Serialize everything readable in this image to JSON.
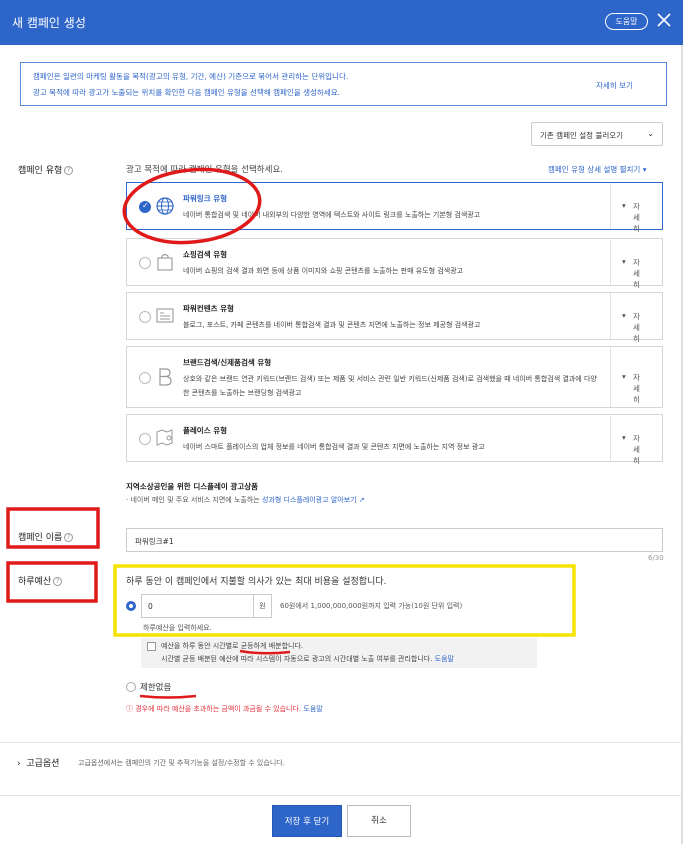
{
  "header": {
    "title": "새 캠페인 생성",
    "help_label": "도움말"
  },
  "info": {
    "line1": "캠페인은 일련의 마케팅 활동을 목적(광고의 유형, 기간, 예산) 기준으로 묶어서 관리하는 단위입니다.",
    "line2": "광고 목적에 따라 광고가 노출되는 위치를 확인한 다음 캠페인 유형을 선택해 캠페인을 생성하세요.",
    "more_label": "자세히 보기"
  },
  "load_existing": {
    "label": "기존 캠페인 설정 불러오기"
  },
  "campaign_type": {
    "label": "캠페인 유형",
    "hint": "광고 목적에 따라 캠페인 유형을 선택하세요.",
    "guide_link": "캠페인 유형 상세 설명 펼치기",
    "detail_label": "자세히",
    "cards": [
      {
        "name": "파워링크 유형",
        "desc": "네이버 통합검색 및 네이버 내외부의 다양한 영역에 텍스트와 사이트 링크를 노출하는 기본형 검색광고",
        "selected": true,
        "icon": "globe-icon"
      },
      {
        "name": "쇼핑검색 유형",
        "desc": "네이버 쇼핑의 검색 결과 화면 등에 상품 이미지와 쇼핑 콘텐츠를 노출하는 판매 유도형 검색광고",
        "selected": false,
        "icon": "shopping-bag-icon"
      },
      {
        "name": "파워컨텐츠 유형",
        "desc": "블로그, 포스트, 카페 콘텐츠를 네이버 통합검색 결과 및 콘텐츠 지면에 노출하는 정보 제공형 검색광고",
        "selected": false,
        "icon": "document-icon"
      },
      {
        "name": "브랜드검색/신제품검색 유형",
        "desc": "상호와 같은 브랜드 연관 키워드(브랜드 검색) 또는 제품 및 서비스 관련 일반 키워드(신제품 검색)로 검색했을 때 네이버 통합검색 결과에 다양한 콘텐츠를 노출하는 브랜딩형 검색광고",
        "selected": false,
        "icon": "brand-b-icon"
      },
      {
        "name": "플레이스 유형",
        "desc": "네이버 스마트 플레이스의 업체 정보를 네이버 통합검색 결과 및 콘텐츠 지면에 노출하는 지역 정보 광고",
        "selected": false,
        "icon": "map-pin-icon"
      }
    ]
  },
  "local_display": {
    "title": "지역소상공인을 위한 디스플레이 광고상품",
    "desc_prefix": "· 네이버 메인 및 주요 서비스 지면에 노출하는",
    "link": "성과형 디스플레이광고 알아보기"
  },
  "campaign_name": {
    "label": "캠페인 이름",
    "value": "파워링크#1",
    "count": "6/30"
  },
  "budget": {
    "label": "하루예산",
    "desc": "하루 동안 이 캠페인에서 지불할 의사가 있는 최대 비용을 설정합니다.",
    "amount": "0",
    "currency": "원",
    "limit": "60원에서 1,000,000,000원까지 입력 가능(10원 단위 입력)",
    "warning": "하루예산을 입력하세요.",
    "even_line1": "예산을 하루 동안 시간별로 균등하게 배분합니다.",
    "even_line2": "시간별 균등 배분된 예산에 따라 시스템이 자동으로 광고의 시간대별 노출 여부를 관리합니다.",
    "even_help": "도움말",
    "no_limit": "제한없음",
    "error_text": "ⓘ 경우에 따라 예산을 초과하는 금액이 과금될 수 있습니다.",
    "error_help": "도움말"
  },
  "advanced": {
    "label": "고급옵션",
    "desc": "고급옵션에서는 캠페인의 기간 및 추적기능을 설정/수정할 수 있습니다."
  },
  "footer": {
    "save_label": "저장 후 닫기",
    "cancel_label": "취소"
  },
  "colors": {
    "brand_blue": "#2e65c9",
    "annotation_red": "#e01a1a",
    "annotation_yellow": "#f5e400"
  }
}
